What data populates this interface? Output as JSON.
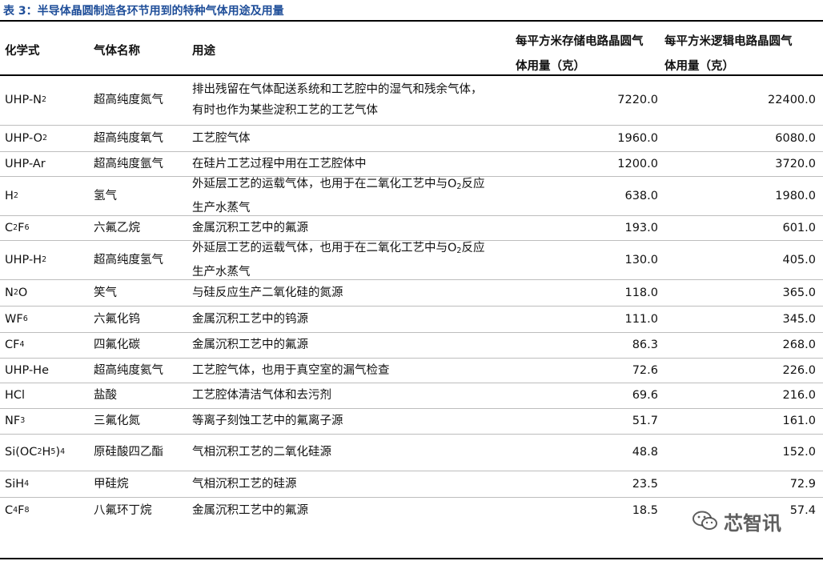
{
  "caption": "表 3：半导体晶圆制造各环节用到的特种气体用途及用量",
  "headers": {
    "formula": "化学式",
    "name": "气体名称",
    "use": "用途",
    "memory_line1": "每平方米存储电路晶圆气",
    "memory_line2": "体用量（克）",
    "logic_line1": "每平方米逻辑电路晶圆气",
    "logic_line2": "体用量（克）"
  },
  "rows": [
    {
      "formula": "UHP-N2",
      "name": "超高纯度氮气",
      "use_line1": "排出残留在气体配送系统和工艺腔中的湿气和残余气体，",
      "use_line2": "有时也作为某些淀积工艺的工艺气体",
      "memory": "7220.0",
      "logic": "22400.0"
    },
    {
      "formula": "UHP-O2",
      "name": "超高纯度氧气",
      "use_line1": "工艺腔气体",
      "use_line2": "",
      "memory": "1960.0",
      "logic": "6080.0"
    },
    {
      "formula": "UHP-Ar",
      "name": "超高纯度氩气",
      "use_line1": "在硅片工艺过程中用在工艺腔体中",
      "use_line2": "",
      "memory": "1200.0",
      "logic": "3720.0"
    },
    {
      "formula": "H2",
      "name": "氢气",
      "use_line1": "外延层工艺的运载气体，也用于在二氧化工艺中与O2反应",
      "use_line2": "生产水蒸气",
      "memory": "638.0",
      "logic": "1980.0"
    },
    {
      "formula": "C2F6",
      "name": "六氟乙烷",
      "use_line1": "金属沉积工艺中的氟源",
      "use_line2": "",
      "memory": "193.0",
      "logic": "601.0"
    },
    {
      "formula": "UHP-H2",
      "name": "超高纯度氢气",
      "use_line1": "外延层工艺的运载气体，也用于在二氧化工艺中与O2反应",
      "use_line2": "生产水蒸气",
      "memory": "130.0",
      "logic": "405.0"
    },
    {
      "formula": "N2O",
      "name": "笑气",
      "use_line1": "与硅反应生产二氧化硅的氮源",
      "use_line2": "",
      "memory": "118.0",
      "logic": "365.0"
    },
    {
      "formula": "WF6",
      "name": "六氟化钨",
      "use_line1": "金属沉积工艺中的钨源",
      "use_line2": "",
      "memory": "111.0",
      "logic": "345.0"
    },
    {
      "formula": "CF4",
      "name": "四氟化碳",
      "use_line1": "金属沉积工艺中的氟源",
      "use_line2": "",
      "memory": "86.3",
      "logic": "268.0"
    },
    {
      "formula": "UHP-He",
      "name": "超高纯度氦气",
      "use_line1": "工艺腔气体，也用于真空室的漏气检查",
      "use_line2": "",
      "memory": "72.6",
      "logic": "226.0"
    },
    {
      "formula": "HCl",
      "name": "盐酸",
      "use_line1": "工艺腔体清洁气体和去污剂",
      "use_line2": "",
      "memory": "69.6",
      "logic": "216.0"
    },
    {
      "formula": "NF3",
      "name": "三氟化氮",
      "use_line1": "等离子刻蚀工艺中的氟离子源",
      "use_line2": "",
      "memory": "51.7",
      "logic": "161.0"
    },
    {
      "formula": "Si(OC2H5)4",
      "name": "原硅酸四乙酯",
      "use_line1": "气相沉积工艺的二氧化硅源",
      "use_line2": "",
      "memory": "48.8",
      "logic": "152.0"
    },
    {
      "formula": "SiH4",
      "name": "甲硅烷",
      "use_line1": "气相沉积工艺的硅源",
      "use_line2": "",
      "memory": "23.5",
      "logic": "72.9"
    },
    {
      "formula": "C4F8",
      "name": "八氟环丁烷",
      "use_line1": "金属沉积工艺中的氟源",
      "use_line2": "",
      "memory": "18.5",
      "logic": "57.4"
    }
  ],
  "watermark": {
    "text": "芯智讯",
    "icon": "wechat-icon"
  }
}
